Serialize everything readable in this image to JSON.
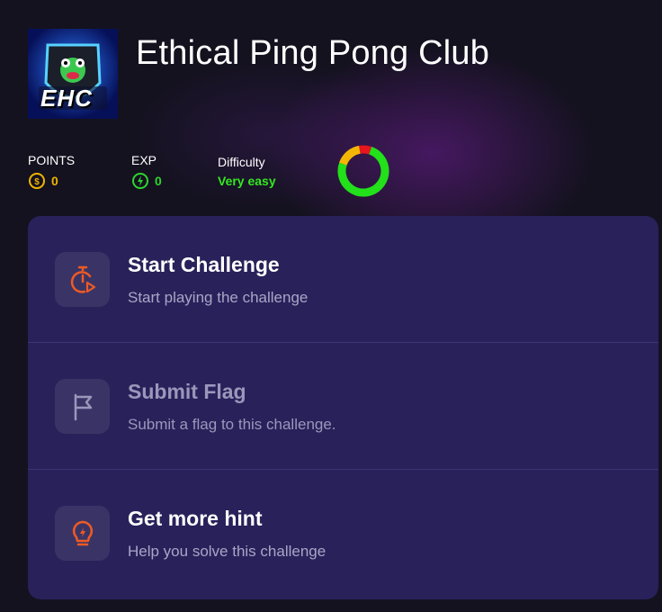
{
  "header": {
    "title": "Ethical Ping Pong Club",
    "logo": {
      "text": "EHC",
      "icon": "ehc-frog-shield-logo"
    }
  },
  "stats": {
    "points": {
      "label": "POINTS",
      "value": "0",
      "icon": "coin-icon",
      "color": "#f0b400"
    },
    "exp": {
      "label": "EXP",
      "value": "0",
      "icon": "exp-icon",
      "color": "#2dd52d"
    },
    "difficulty": {
      "label": "Difficulty",
      "value": "Very easy",
      "color": "#33e820"
    }
  },
  "difficulty_chart": {
    "type": "donut",
    "segments": [
      {
        "name": "green",
        "fraction": 0.75,
        "color": "#22e01a"
      },
      {
        "name": "yellow",
        "fraction": 0.17,
        "color": "#f2b705"
      },
      {
        "name": "red",
        "fraction": 0.08,
        "color": "#e8141e"
      }
    ]
  },
  "actions": [
    {
      "title": "Start Challenge",
      "desc": "Start playing the challenge",
      "icon": "timer-play-icon",
      "enabled": true
    },
    {
      "title": "Submit Flag",
      "desc": "Submit a flag to this challenge.",
      "icon": "flag-icon",
      "enabled": false
    },
    {
      "title": "Get more hint",
      "desc": "Help you solve this challenge",
      "icon": "lightbulb-icon",
      "enabled": true
    }
  ],
  "colors": {
    "accent_orange": "#ee5a24",
    "panel_bg": "#29215a",
    "page_bg": "#14121f"
  }
}
